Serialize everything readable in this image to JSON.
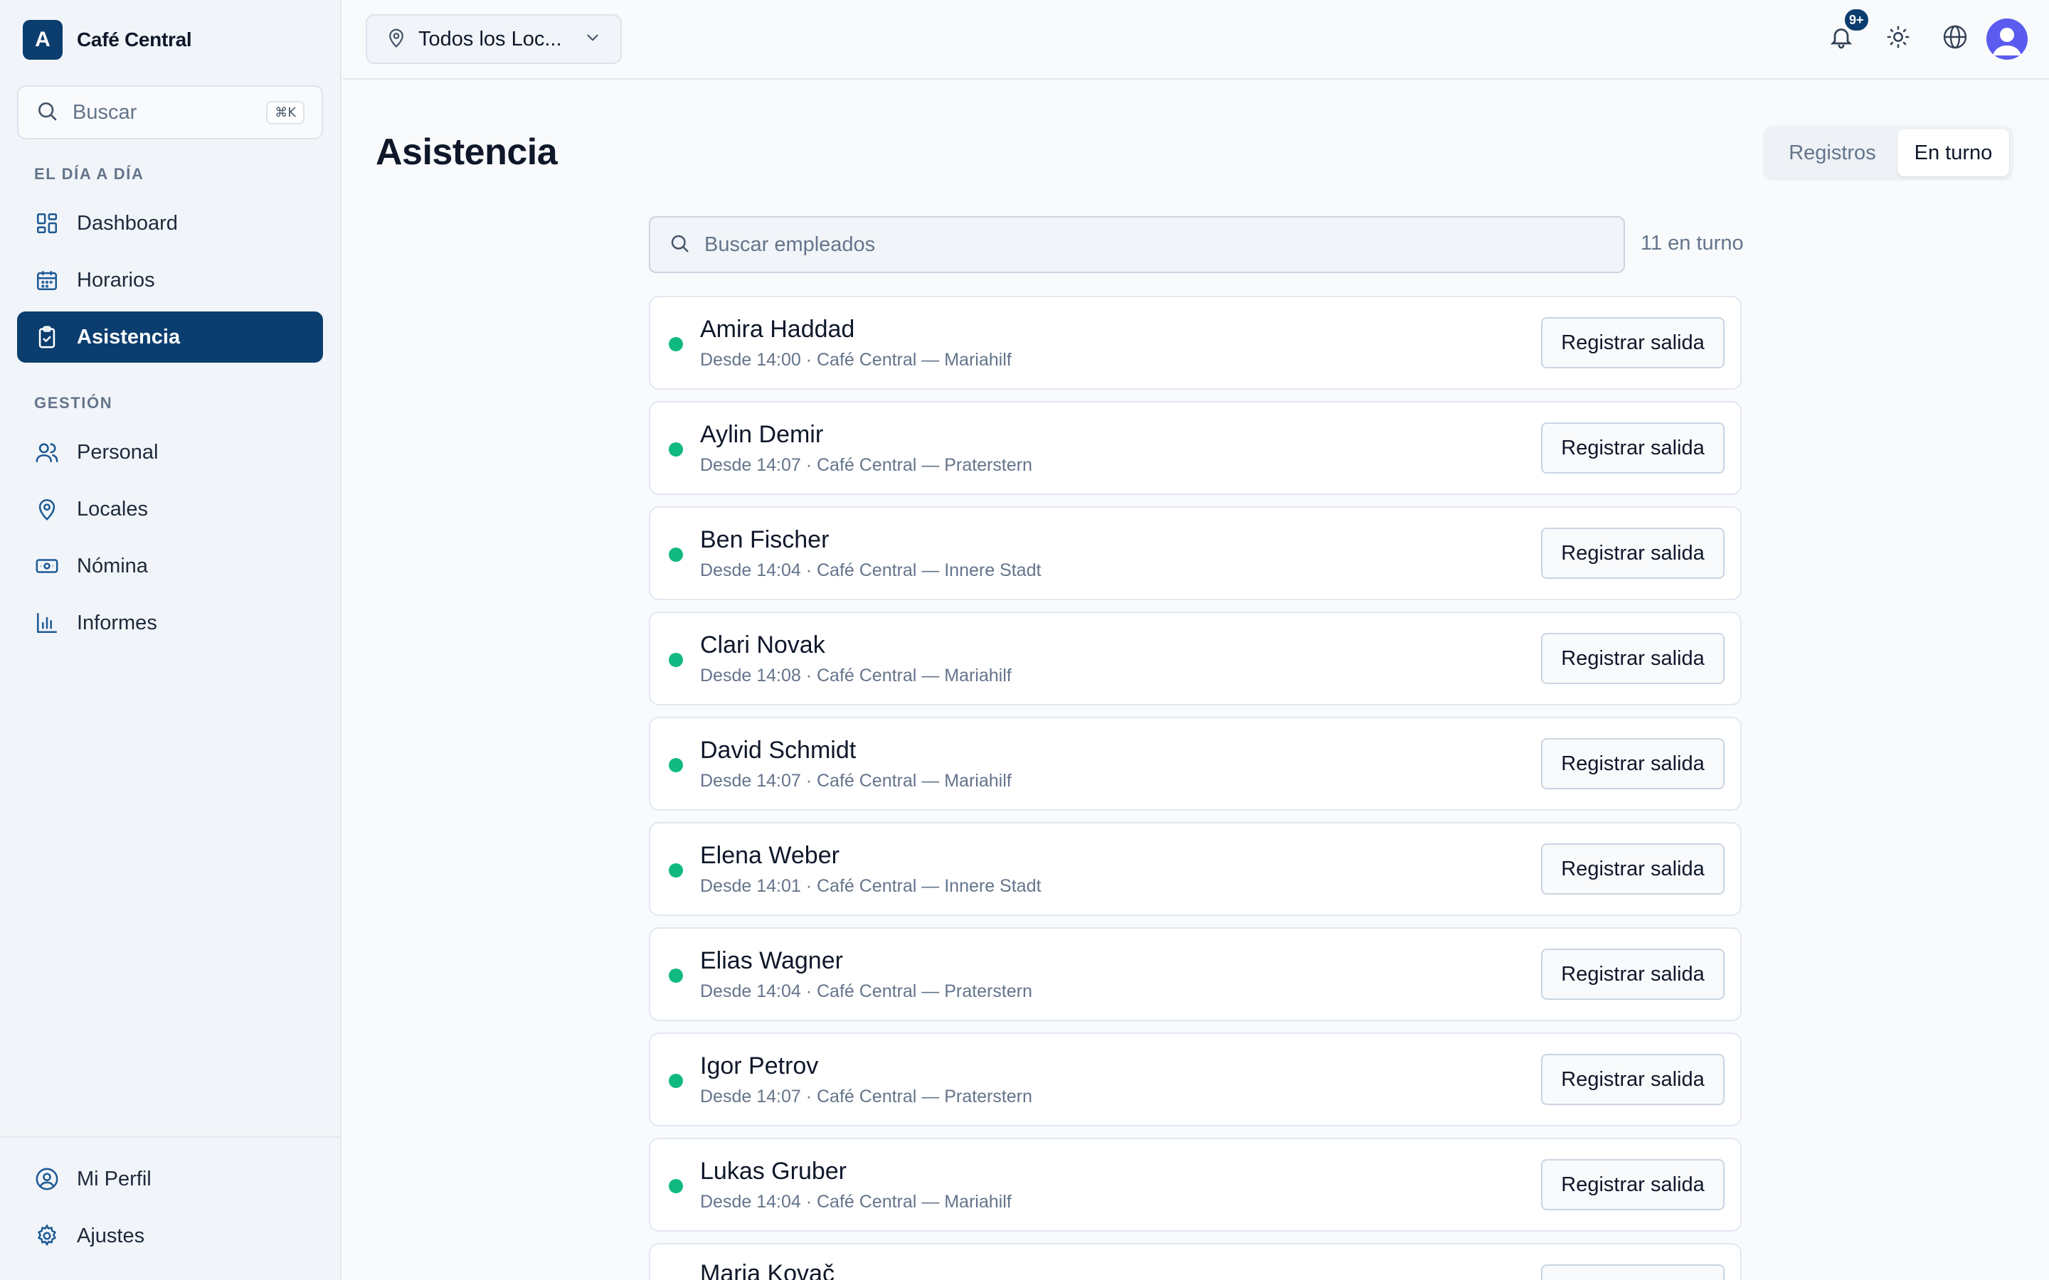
{
  "app": {
    "brand_initial": "A",
    "brand_name": "Café Central"
  },
  "sidebar": {
    "search_placeholder": "Buscar",
    "search_shortcut": "⌘K",
    "sections": [
      {
        "label": "EL DÍA A DÍA",
        "items": [
          {
            "label": "Dashboard",
            "icon": "grid-icon"
          },
          {
            "label": "Horarios",
            "icon": "calendar-icon"
          },
          {
            "label": "Asistencia",
            "icon": "clipboard-check-icon",
            "active": true
          }
        ]
      },
      {
        "label": "GESTIÓN",
        "items": [
          {
            "label": "Personal",
            "icon": "users-icon"
          },
          {
            "label": "Locales",
            "icon": "map-pin-icon"
          },
          {
            "label": "Nómina",
            "icon": "banknote-icon"
          },
          {
            "label": "Informes",
            "icon": "bar-chart-icon"
          }
        ]
      }
    ],
    "bottom_items": [
      {
        "label": "Mi Perfil",
        "icon": "user-circle-icon"
      },
      {
        "label": "Ajustes",
        "icon": "gear-icon"
      }
    ]
  },
  "topbar": {
    "location_select": "Todos los Loc...",
    "notifications_badge": "9+"
  },
  "main": {
    "title": "Asistencia",
    "tabs": [
      {
        "label": "Registros",
        "active": false
      },
      {
        "label": "En turno",
        "active": true
      }
    ],
    "search_placeholder": "Buscar empleados",
    "count_label": "11 en turno",
    "action_label": "Registrar salida",
    "employees": [
      {
        "name": "Amira Haddad",
        "details": "Desde 14:00 · Café Central — Mariahilf"
      },
      {
        "name": "Aylin Demir",
        "details": "Desde 14:07 · Café Central — Praterstern"
      },
      {
        "name": "Ben Fischer",
        "details": "Desde 14:04 · Café Central — Innere Stadt"
      },
      {
        "name": "Clari Novak",
        "details": "Desde 14:08 · Café Central — Mariahilf"
      },
      {
        "name": "David Schmidt",
        "details": "Desde 14:07 · Café Central — Mariahilf"
      },
      {
        "name": "Elena Weber",
        "details": "Desde 14:01 · Café Central — Innere Stadt"
      },
      {
        "name": "Elias Wagner",
        "details": "Desde 14:04 · Café Central — Praterstern"
      },
      {
        "name": "Igor Petrov",
        "details": "Desde 14:07 · Café Central — Praterstern"
      },
      {
        "name": "Lukas Gruber",
        "details": "Desde 14:04 · Café Central — Mariahilf"
      },
      {
        "name": "Maria Kovač",
        "details": ""
      }
    ]
  },
  "colors": {
    "accent": "#0b3d6e",
    "status_on": "#10b981",
    "avatar": "#5b5bf0"
  }
}
